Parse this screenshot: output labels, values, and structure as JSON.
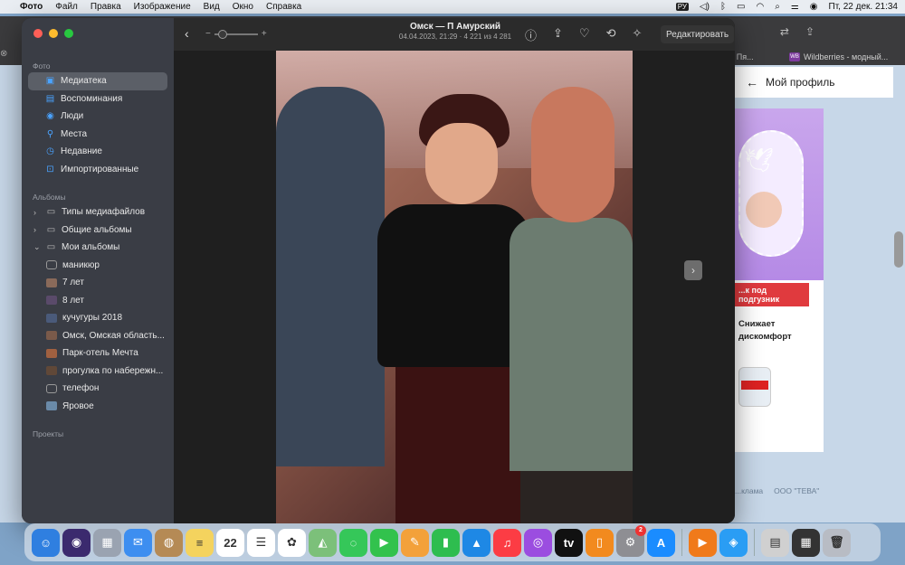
{
  "menubar": {
    "apple_icon": "apple-logo",
    "app_name": "Фото",
    "menus": [
      "Файл",
      "Правка",
      "Изображение",
      "Вид",
      "Окно",
      "Справка"
    ],
    "input_source": "РУ",
    "datetime": "Пт, 22 дек.  21:34"
  },
  "browser": {
    "tabs": [
      "...д. Пя...",
      "Wildberries - модный..."
    ],
    "tab_favicon": "WB",
    "profile_label": "Мой профиль",
    "ad_heading": "...к под подгузник",
    "ad_text_line1": "Снижает",
    "ad_text_line2": "дискомфорт",
    "footer_left": "...клама",
    "footer_right": "ООО \"ТЕВА\""
  },
  "photos": {
    "sidebar": {
      "section_photos": "Фото",
      "items": [
        {
          "label": "Медиатека",
          "icon": "library-icon",
          "active": true
        },
        {
          "label": "Воспоминания",
          "icon": "memories-icon"
        },
        {
          "label": "Люди",
          "icon": "people-icon"
        },
        {
          "label": "Места",
          "icon": "places-icon"
        },
        {
          "label": "Недавние",
          "icon": "recents-icon"
        },
        {
          "label": "Импортированные",
          "icon": "imports-icon"
        }
      ],
      "section_albums": "Альбомы",
      "album_groups": [
        {
          "label": "Типы медиафайлов",
          "expanded": false
        },
        {
          "label": "Общие альбомы",
          "expanded": false
        },
        {
          "label": "Мои альбомы",
          "expanded": true
        }
      ],
      "albums": [
        {
          "label": "маникюр",
          "thumb": "empty"
        },
        {
          "label": "7 лет",
          "thumb": "#8a6a5a"
        },
        {
          "label": "8 лет",
          "thumb": "#5a4a6a"
        },
        {
          "label": "кучугуры 2018",
          "thumb": "#4a5a7a"
        },
        {
          "label": "Омск, Омская область...",
          "thumb": "#7a5a4a"
        },
        {
          "label": "Парк-отель Мечта",
          "thumb": "#a06040"
        },
        {
          "label": "прогулка по набережн...",
          "thumb": "#604838"
        },
        {
          "label": "телефон",
          "thumb": "empty"
        },
        {
          "label": "Яровое",
          "thumb": "#6a8aa8"
        }
      ],
      "section_projects": "Проекты"
    },
    "toolbar": {
      "title": "Омск — П Амурский",
      "subtitle": "04.04.2023, 21:29  ·  4 221 из 4 281",
      "zoom_minus": "−",
      "zoom_plus": "+",
      "edit_label": "Редактировать"
    }
  },
  "dock": {
    "apps": [
      {
        "name": "finder",
        "bg": "#2f7fe0",
        "glyph": "☺"
      },
      {
        "name": "siri",
        "bg": "#3b2a6e",
        "glyph": "◉"
      },
      {
        "name": "launchpad",
        "bg": "#9aa3b1",
        "glyph": "▦"
      },
      {
        "name": "mail",
        "bg": "#3d8ef0",
        "glyph": "✉"
      },
      {
        "name": "contacts",
        "bg": "#b58a55",
        "glyph": "◍"
      },
      {
        "name": "notes",
        "bg": "#f4d35e",
        "glyph": "≡"
      },
      {
        "name": "calendar",
        "bg": "#ffffff",
        "glyph": "22"
      },
      {
        "name": "reminders",
        "bg": "#ffffff",
        "glyph": "☰"
      },
      {
        "name": "photos",
        "bg": "#ffffff",
        "glyph": "✿"
      },
      {
        "name": "maps",
        "bg": "#7cc07a",
        "glyph": "◭"
      },
      {
        "name": "messages",
        "bg": "#35c759",
        "glyph": "◌"
      },
      {
        "name": "facetime",
        "bg": "#32c24d",
        "glyph": "▶"
      },
      {
        "name": "pages",
        "bg": "#f3a13a",
        "glyph": "✎"
      },
      {
        "name": "numbers",
        "bg": "#2ebd4f",
        "glyph": "▮"
      },
      {
        "name": "keynote",
        "bg": "#1e88e5",
        "glyph": "▲"
      },
      {
        "name": "music",
        "bg": "#fc3c44",
        "glyph": "♫"
      },
      {
        "name": "podcasts",
        "bg": "#9b4de0",
        "glyph": "◎"
      },
      {
        "name": "tv",
        "bg": "#111111",
        "glyph": "tv"
      },
      {
        "name": "books",
        "bg": "#f28a1e",
        "glyph": "▯"
      },
      {
        "name": "system-settings",
        "bg": "#8e8e93",
        "glyph": "⚙",
        "badge": "2"
      },
      {
        "name": "app-store",
        "bg": "#1a8cff",
        "glyph": "A"
      },
      {
        "name": "infuse",
        "bg": "#f07a1a",
        "glyph": "▶"
      },
      {
        "name": "safari",
        "bg": "#2a9df4",
        "glyph": "◈"
      },
      {
        "name": "window-thumb-1",
        "bg": "#d0d0d0",
        "glyph": "▤"
      },
      {
        "name": "window-thumb-2",
        "bg": "#333333",
        "glyph": "▦"
      },
      {
        "name": "trash",
        "bg": "#b8bcc4",
        "glyph": "🗑"
      }
    ]
  }
}
